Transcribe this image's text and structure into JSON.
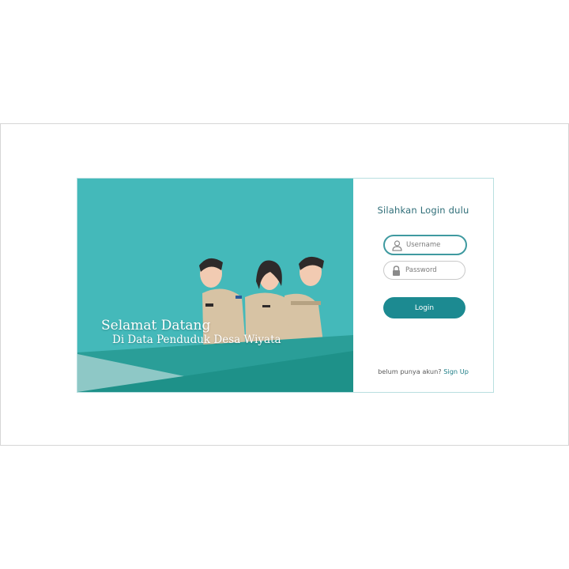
{
  "welcome": {
    "title": "Selamat Datang",
    "subtitle": "Di Data Penduduk Desa Wiyata"
  },
  "login": {
    "title": "Silahkan Login dulu",
    "username_placeholder": "Username",
    "password_placeholder": "Password",
    "button_label": "Login",
    "signup_prompt": "belum punya akun?",
    "signup_link": "Sign Up"
  },
  "icons": {
    "username": "user-icon",
    "password": "lock-icon"
  },
  "colors": {
    "hero_bg": "#44b9ba",
    "accent": "#1c8a91",
    "title_text": "#2f6e78"
  }
}
